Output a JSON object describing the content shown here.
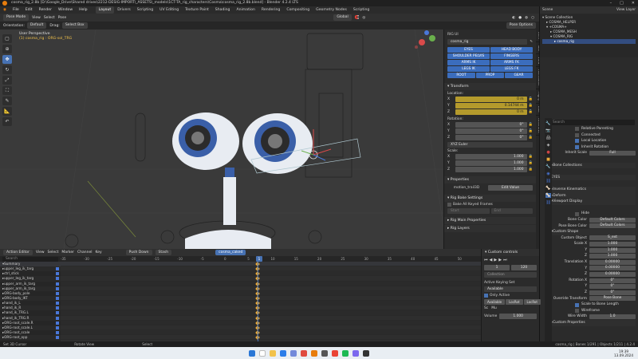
{
  "titlebar": {
    "title": "cosma_rig_2.8b [D:\\Google_Drive\\Shared drives\\2212-DESIG-IMPORT\\_ASSETS\\_models\\1CT-TA_rig_characters\\Cosma\\cosma_rig_2.8b.blend] - Blender 4.2.4 LTS"
  },
  "menubar": {
    "menus": [
      "File",
      "Edit",
      "Render",
      "Window",
      "Help"
    ],
    "workspaces": [
      "Layout",
      "Drivers",
      "Scripting",
      "UV Editing",
      "Texture Paint",
      "Shading",
      "Animation",
      "Rendering",
      "Compositing",
      "Geometry Nodes",
      "Scripting"
    ],
    "active_workspace": "Layout",
    "scene_label": "Scene",
    "view_layer_label": "View Layer"
  },
  "viewport_header": {
    "mode": "Pose Mode",
    "menus": [
      "View",
      "Select",
      "Pose"
    ],
    "transform": "Global",
    "orientation_label": "Orientation:",
    "orientation_value": "Default",
    "drag_label": "Drag:",
    "drag_value": "Select Box",
    "pose_options": "Pose Options"
  },
  "viewport": {
    "view_name": "User Perspective",
    "object_info": "(1) cosma_rig : ORG-sol_TRG"
  },
  "npanel": {
    "rig_ui_title": "RIG UI",
    "rig_name": "cosma_rig",
    "rig_buttons": [
      [
        "EYES",
        "HEAD BODY"
      ],
      [
        "SHOULDER PELVIS",
        "FINGERS"
      ],
      [
        "ARMS IK",
        "ARMS FK"
      ],
      [
        "LEGS IK",
        "LEGS FK"
      ],
      [
        "ROOT",
        "PROP",
        "GEAR"
      ]
    ],
    "transform_title": "Transform",
    "location_label": "Location:",
    "location": [
      {
        "axis": "X",
        "value": "0 m"
      },
      {
        "axis": "Y",
        "value": "0.14744 m"
      },
      {
        "axis": "Z",
        "value": "0 m"
      }
    ],
    "rotation_label": "Rotation:",
    "rotation": [
      {
        "axis": "X",
        "value": "0°"
      },
      {
        "axis": "Y",
        "value": "0°"
      },
      {
        "axis": "Z",
        "value": "0°"
      }
    ],
    "rotation_mode": "XYZ Euler",
    "scale_label": "Scale:",
    "scale": [
      {
        "axis": "X",
        "value": "1.000"
      },
      {
        "axis": "Y",
        "value": "1.000"
      },
      {
        "axis": "Z",
        "value": "1.000"
      }
    ],
    "properties_title": "Properties",
    "property_name": "motion_trail3D",
    "property_button": "Edit Value",
    "rig_bake_title": "Rig Bake Settings",
    "bake_all": "Bake All Keyed Frames",
    "start_label": "Start",
    "end_label": "End",
    "rig_main_title": "Rig Main Properties",
    "rig_layers_title": "Rig Layers",
    "side_tabs": [
      "Item",
      "Tool",
      "View",
      "Animation",
      "Rigify",
      "Edit",
      "MACHIN3"
    ]
  },
  "outliner": {
    "title": "Scene Collection",
    "items": [
      {
        "label": "Scene Collection",
        "indent": 0
      },
      {
        "label": "COSMA_HELPER",
        "indent": 1
      },
      {
        "label": "+COSMA+",
        "indent": 1
      },
      {
        "label": "COSMA_MESH",
        "indent": 2
      },
      {
        "label": "COSMA_RIG",
        "indent": 2
      },
      {
        "label": "cosma_rig",
        "indent": 3,
        "selected": true
      }
    ]
  },
  "properties": {
    "search_placeholder": "Search",
    "rows": [
      {
        "label": "Relative Parenting",
        "kind": "check",
        "checked": false
      },
      {
        "label": "Connected",
        "kind": "check",
        "checked": false
      },
      {
        "label": "Local Location",
        "kind": "check",
        "checked": true
      },
      {
        "label": "Inherit Rotation",
        "kind": "check",
        "checked": true
      },
      {
        "label": "Inherit Scale",
        "kind": "field",
        "value": "Full"
      },
      {
        "label": "",
        "kind": "blank"
      },
      {
        "label": "Bone Collections",
        "kind": "section"
      },
      {
        "label": "",
        "kind": "blank"
      },
      {
        "label": "EYES",
        "kind": "header"
      },
      {
        "label": "",
        "kind": "blank"
      },
      {
        "label": "Inverse Kinematics",
        "kind": "section"
      },
      {
        "label": "Deform",
        "kind": "section"
      },
      {
        "label": "Viewport Display",
        "kind": "section-open"
      },
      {
        "label": "",
        "kind": "blank"
      },
      {
        "label": "Hide",
        "kind": "check",
        "checked": false
      },
      {
        "label": "Bone Color",
        "kind": "field",
        "value": "Default Colors"
      },
      {
        "label": "Pose Bone Color",
        "kind": "field",
        "value": "Default Colors"
      },
      {
        "label": "Custom Shape",
        "kind": "section-open"
      },
      {
        "label": "Custom Object",
        "kind": "field",
        "value": "S_ext"
      },
      {
        "label": "Scale X",
        "kind": "field",
        "value": "1.000"
      },
      {
        "label": "Y",
        "kind": "field",
        "value": "1.000"
      },
      {
        "label": "Z",
        "kind": "field",
        "value": "1.000"
      },
      {
        "label": "Translation X",
        "kind": "field",
        "value": "0.00000"
      },
      {
        "label": "Y",
        "kind": "field",
        "value": "0.00000"
      },
      {
        "label": "Z",
        "kind": "field",
        "value": "0.00000"
      },
      {
        "label": "Rotation X",
        "kind": "field",
        "value": "0°"
      },
      {
        "label": "Y",
        "kind": "field",
        "value": "0°"
      },
      {
        "label": "Z",
        "kind": "field",
        "value": "0°"
      },
      {
        "label": "Override Transform",
        "kind": "field",
        "value": "Pose Bone"
      },
      {
        "label": "Scale to Bone Length",
        "kind": "check",
        "checked": true
      },
      {
        "label": "Wireframe",
        "kind": "check",
        "checked": false
      },
      {
        "label": "Wire Width",
        "kind": "field",
        "value": "1.0"
      },
      {
        "label": "Custom Properties",
        "kind": "section"
      }
    ]
  },
  "action_editor": {
    "editor": "Action Editor",
    "menus": [
      "View",
      "Select",
      "Marker",
      "Channel",
      "Key"
    ],
    "push_down": "Push Down",
    "stash": "Stash",
    "action_name": "cosma_caked",
    "search_placeholder": "Search",
    "ruler": [
      "-35",
      "-30",
      "-25",
      "-20",
      "-15",
      "-10",
      "-5",
      "0",
      "5",
      "10",
      "15",
      "20",
      "25",
      "30",
      "35",
      "40",
      "45",
      "50"
    ],
    "current_frame": "1",
    "channels": [
      "Summary",
      "upper_leg_ik_targ",
      "ctrl_stick",
      "upper_leg_ik_targ",
      "upper_arm_ik_targ",
      "upper_arm_ik_targ",
      "ORG-body_pole",
      "ORG-body_IKT",
      "hand_ik_L",
      "hand_ik_R",
      "hand_ik_TRG.L",
      "hand_ik_TRG.R",
      "ORG-root_scale.R",
      "ORG-root_scale.L",
      "ORG-root_scale",
      "ORG-root_opp"
    ]
  },
  "ae_side": {
    "title": "Custom controls",
    "frame_label": "1",
    "end_frame": "120",
    "collection_label": "Collection",
    "keying_title": "Active Keying Set",
    "keying_value": "Available",
    "only_active": "Only Active",
    "available": "Available",
    "loc_rot": "LocRot",
    "loc_rot2": "LocRot",
    "sc": "Sc",
    "mu": "Mu",
    "volume_label": "Volume",
    "volume_value": "1.000"
  },
  "statusbar": {
    "left": "Set 3D Cursor",
    "mid1": "Rotate View",
    "mid2": "Select",
    "right": "cosma_rig | Bones 1/291 | Objects 1/211 | 4.2.4"
  },
  "taskbar": {
    "time": "19:39",
    "date": "13.09.2024"
  },
  "colors": {
    "accent": "#4772b3",
    "rig_button": "#3b6dbd",
    "highlight_field": "#b49a2c",
    "keyframe": "#e8a93a"
  }
}
